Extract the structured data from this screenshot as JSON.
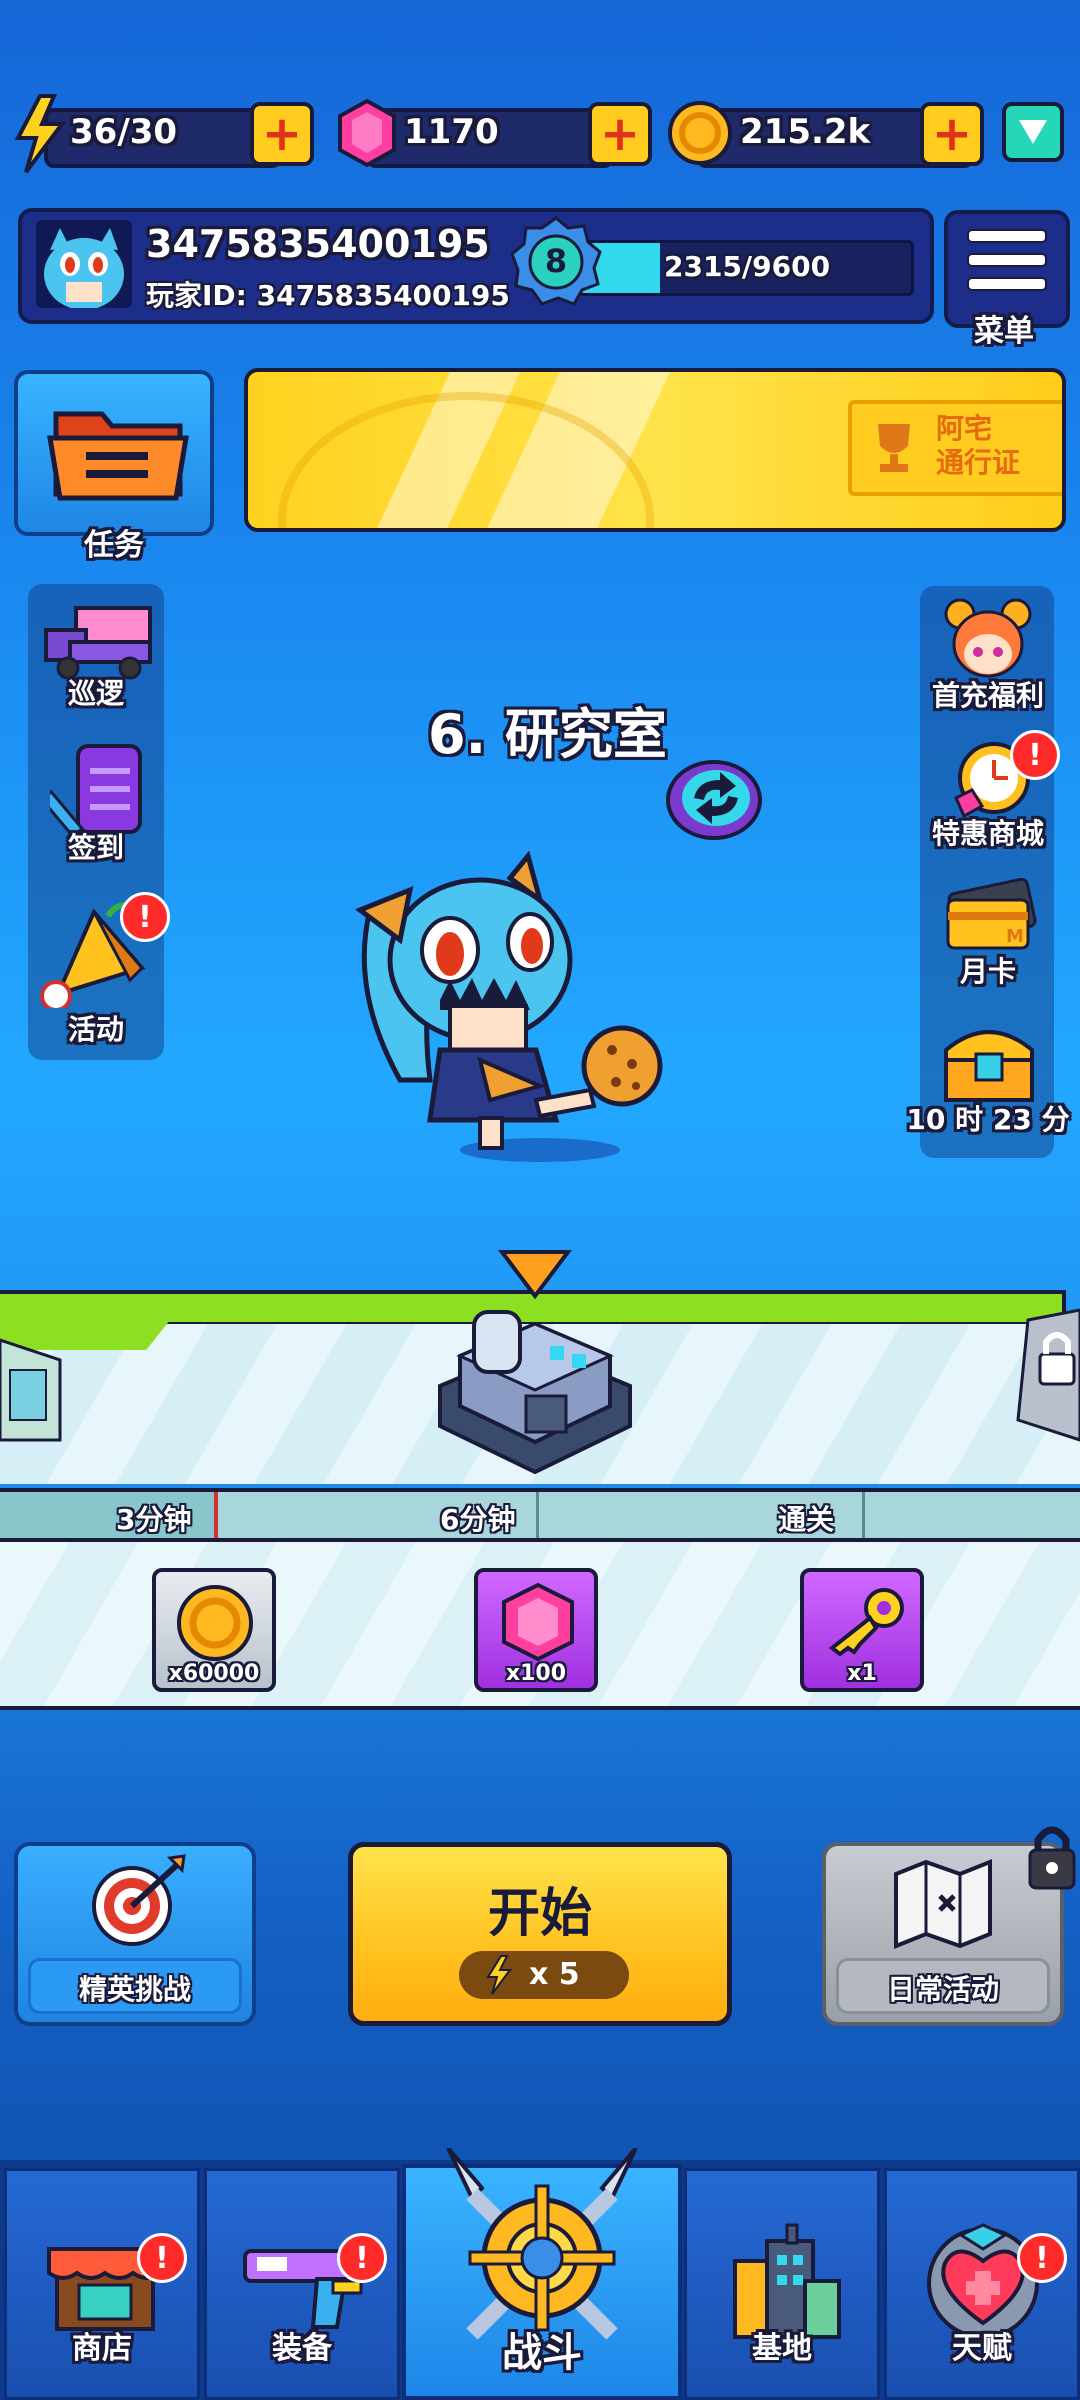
{
  "resources": {
    "energy": "36/30",
    "gems": "1170",
    "coins": "215.2k"
  },
  "profile": {
    "name": "3475835400195",
    "player_id": "玩家ID: 3475835400195",
    "level": "8",
    "xp": "2315/9600",
    "xp_progress": 0.24
  },
  "menu_label": "菜单",
  "task_label": "任务",
  "pass_banner": "阿宅\n通行证",
  "left_side": [
    {
      "label": "巡逻",
      "icon": "truck-icon"
    },
    {
      "label": "签到",
      "icon": "checkin-icon"
    },
    {
      "label": "活动",
      "icon": "event-icon",
      "alert": "!"
    }
  ],
  "right_side": [
    {
      "label": "首充福利",
      "icon": "first-recharge-icon"
    },
    {
      "label": "特惠商城",
      "icon": "special-shop-icon",
      "alert": "!"
    },
    {
      "label": "月卡",
      "icon": "month-card-icon"
    },
    {
      "label": "10 时 23 分",
      "icon": "chest-icon"
    }
  ],
  "stage": {
    "title": "6. 研究室"
  },
  "milestones": [
    "3分钟",
    "6分钟",
    "通关"
  ],
  "rewards": [
    {
      "qty": "x60000",
      "icon": "coin-icon"
    },
    {
      "qty": "x100",
      "icon": "gem-icon"
    },
    {
      "qty": "x1",
      "icon": "key-icon"
    }
  ],
  "actions": {
    "elite": "精英挑战",
    "start": "开始",
    "start_cost": "x 5",
    "daily": "日常活动"
  },
  "tabs": [
    {
      "label": "商店",
      "alert": "!"
    },
    {
      "label": "装备",
      "alert": "!"
    },
    {
      "label": "战斗"
    },
    {
      "label": "基地"
    },
    {
      "label": "天赋",
      "alert": "!"
    }
  ],
  "colors": {
    "accent_yellow": "#ffcc1f",
    "alert_red": "#ff2b2b",
    "panel_blue": "#1d2e8a",
    "green_strip": "#8ce021"
  }
}
